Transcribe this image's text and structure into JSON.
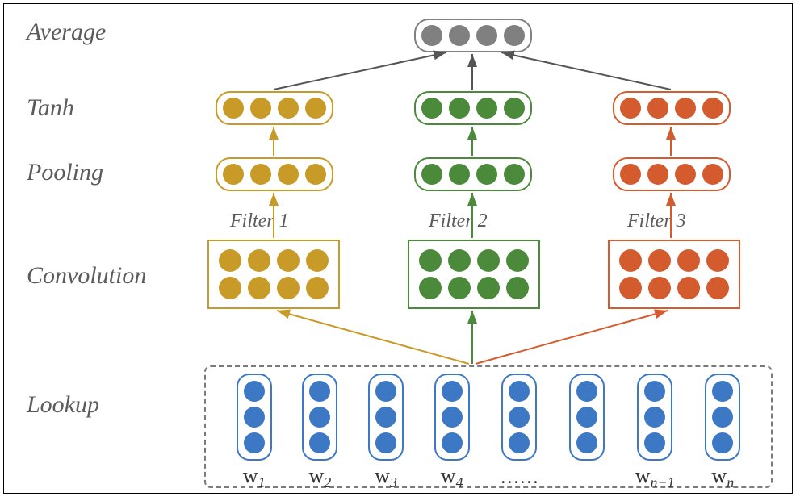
{
  "labels": {
    "average": "Average",
    "tanh": "Tanh",
    "pooling": "Pooling",
    "convolution": "Convolution",
    "lookup": "Lookup"
  },
  "filters": {
    "f1": "Filter 1",
    "f2": "Filter 2",
    "f3": "Filter 3"
  },
  "tokens": {
    "w1": "w",
    "w1s": "1",
    "w2": "w",
    "w2s": "2",
    "w3": "w",
    "w3s": "3",
    "w4": "w",
    "w4s": "4",
    "dots": "……",
    "wn1": "w",
    "wn1s": "n−1",
    "wn": "w",
    "wns": "n"
  },
  "colors": {
    "gray": "#808080",
    "gold": "#c89a27",
    "green": "#4a8a3a",
    "orange": "#d35b2e",
    "blue": "#3d78c4"
  }
}
